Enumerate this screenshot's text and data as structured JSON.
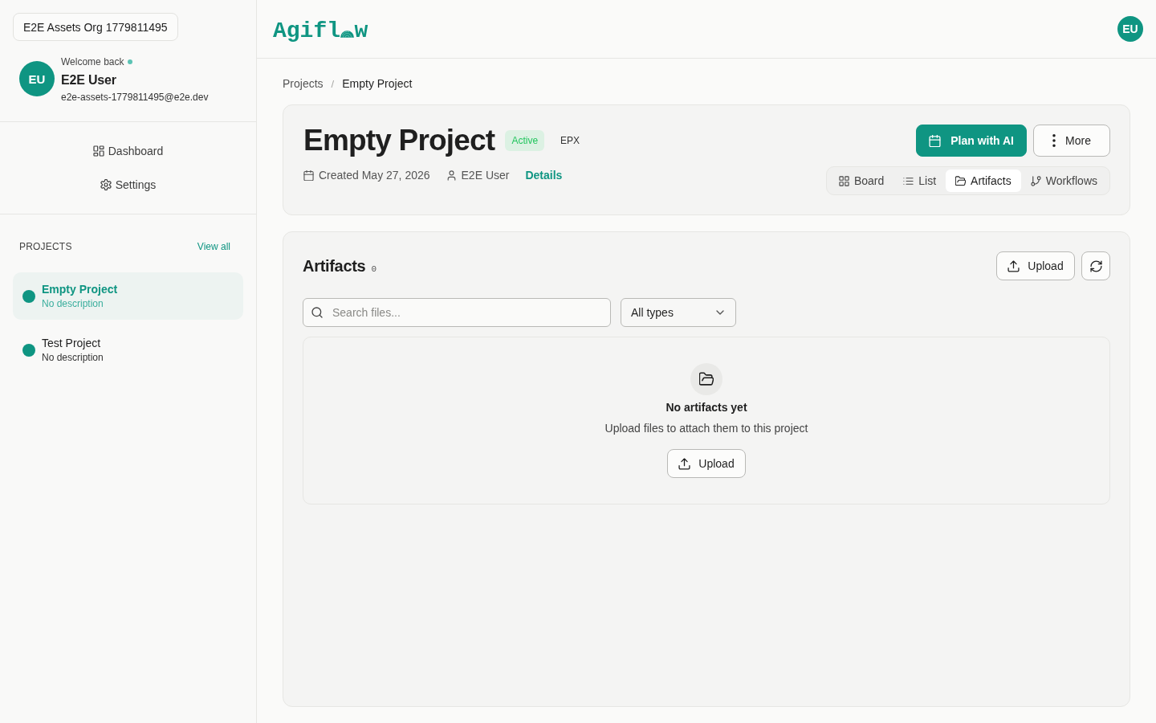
{
  "sidebar": {
    "org_switcher": {
      "label": "E2E Assets Org 1779811495"
    },
    "user": {
      "avatar": "EU",
      "greeting": "Welcome back",
      "online": true,
      "name": "E2E User",
      "email": "e2e-assets-1779811495@e2e.dev"
    },
    "nav": [
      {
        "label": "Dashboard"
      },
      {
        "label": "Settings"
      }
    ],
    "projects": {
      "heading": "PROJECTS",
      "view_all": "View all",
      "items": [
        {
          "name": "Empty Project",
          "description": "No description",
          "selected": true,
          "color": "#0f9582"
        },
        {
          "name": "Test Project",
          "description": "No description",
          "selected": false,
          "color": "#0f9582"
        }
      ]
    }
  },
  "header": {
    "logo_start": "Agifl",
    "logo_end": "w",
    "avatar": "EU"
  },
  "breadcrumb": {
    "separator": "/",
    "items": [
      {
        "label": "Projects",
        "current": false
      },
      {
        "label": "Empty Project",
        "current": true
      }
    ]
  },
  "project": {
    "title": "Empty Project",
    "status": "Active",
    "code": "EPX",
    "created": "Created May 27, 2026",
    "owner": "E2E User",
    "details_link": "Details",
    "actions": [
      {
        "kind": "primary",
        "label": "Plan with AI"
      },
      {
        "kind": "secondary",
        "label": "More"
      }
    ],
    "views": [
      {
        "label": "Board",
        "selected": false
      },
      {
        "label": "List",
        "selected": false
      },
      {
        "label": "Artifacts",
        "selected": true
      },
      {
        "label": "Workflows",
        "selected": false
      }
    ]
  },
  "artifacts": {
    "title": "Artifacts",
    "count": "0",
    "upload_label": "Upload",
    "search": {
      "placeholder": "Search files..."
    },
    "type_filter": {
      "value": "All types"
    },
    "empty_state": {
      "title": "No artifacts yet",
      "message": "Upload files to attach them to this project",
      "button": "Upload"
    }
  }
}
